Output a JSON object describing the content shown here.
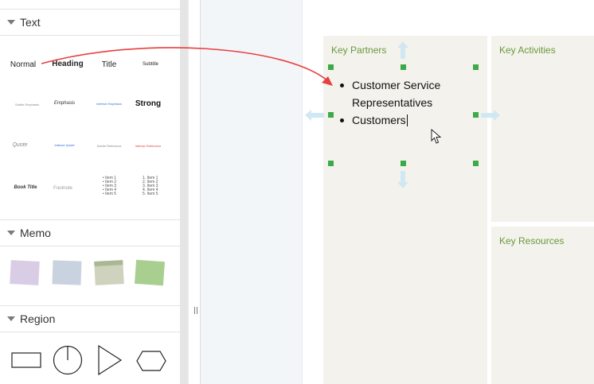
{
  "left_panel": {
    "text_section": {
      "title": "Text",
      "styles": [
        {
          "label": "Normal"
        },
        {
          "label": "Heading"
        },
        {
          "label": "Title"
        },
        {
          "label": "Subtitle"
        },
        {
          "label": "Subtle Emphasis"
        },
        {
          "label": "Emphasis"
        },
        {
          "label": "Intense Emphasis"
        },
        {
          "label": "Strong"
        },
        {
          "label": "Quote"
        },
        {
          "label": "Intense Quote"
        },
        {
          "label": "Subtle Reference"
        },
        {
          "label": "Intense Reference"
        },
        {
          "label": "Book Title"
        },
        {
          "label": "Footnote"
        }
      ],
      "bullet_list": [
        "Item 1",
        "Item 2",
        "Item 3",
        "Item 4",
        "Item 5"
      ],
      "numbered_list": [
        "1. Item 1",
        "2. Item 2",
        "3. Item 3",
        "4. Item 4",
        "5. Item 5"
      ]
    },
    "memo_section": {
      "title": "Memo",
      "memo_colors": [
        "#d9cde6",
        "#c9d3e0",
        "#cfd3bd",
        "#a8cf8f"
      ]
    },
    "region_section": {
      "title": "Region",
      "shapes": [
        "rectangle-icon",
        "circle-sector-icon",
        "triangle-icon",
        "hexagon-icon"
      ]
    },
    "splitter_handle": "||"
  },
  "canvas": {
    "regions": [
      {
        "title": "Key Partners"
      },
      {
        "title": "Key Activities"
      },
      {
        "title": "Key Resources"
      }
    ],
    "bullets": [
      "Customer Service",
      "Representatives",
      "Customers"
    ]
  },
  "colors": {
    "region_bg": "#f3f2ed",
    "region_title": "#6a9a3a",
    "handle": "#3daa4a",
    "drag_arrow": "#e84040",
    "move_arrow": "#cfe8f3"
  }
}
